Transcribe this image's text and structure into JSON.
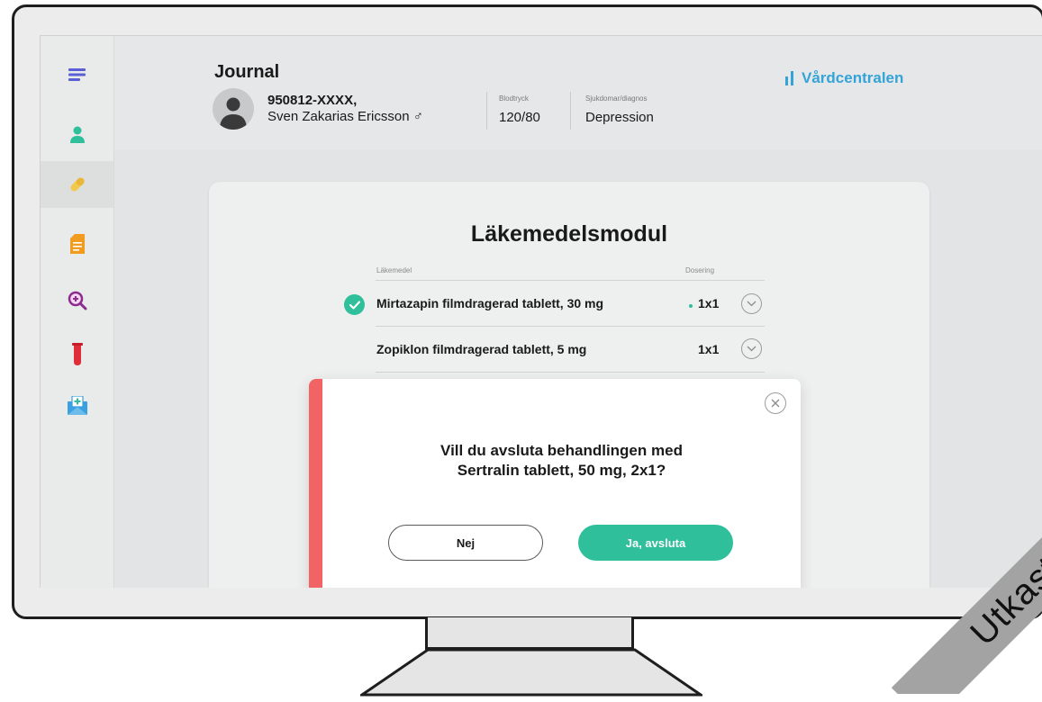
{
  "watermark": "Utkast",
  "sidebar": {
    "items": [
      {
        "icon": "menu-icon"
      },
      {
        "icon": "user-icon"
      },
      {
        "icon": "pill-icon",
        "active": true
      },
      {
        "icon": "document-icon"
      },
      {
        "icon": "search-plus-icon"
      },
      {
        "icon": "test-tube-icon"
      },
      {
        "icon": "medical-mail-icon"
      }
    ]
  },
  "header": {
    "title": "Journal",
    "patient_id": "950812-XXXX,",
    "patient_name": "Sven Zakarias Ericsson",
    "gender_symbol": "♂",
    "blood_pressure_label": "Blodtryck",
    "blood_pressure_value": "120/80",
    "diagnosis_label": "Sjukdomar/diagnos",
    "diagnosis_value": "Depression",
    "brand": "Vårdcentralen"
  },
  "module": {
    "title": "Läkemedelsmodul",
    "col_medicine": "Läkemedel",
    "col_dosage": "Dosering",
    "rows": [
      {
        "name": "Mirtazapin filmdragerad tablett, 30 mg",
        "dose": "1x1",
        "checked": true
      },
      {
        "name": "Zopiklon filmdragerad tablett, 5 mg",
        "dose": "1x1",
        "checked": false
      }
    ]
  },
  "dialog": {
    "question_line1": "Vill du avsluta behandlingen med",
    "question_line2": "Sertralin tablett, 50 mg, 2x1?",
    "no_label": "Nej",
    "yes_label": "Ja, avsluta"
  },
  "colors": {
    "accent_green": "#2fbf9b",
    "alert_red": "#f26464",
    "brand_blue": "#34a3d8"
  }
}
